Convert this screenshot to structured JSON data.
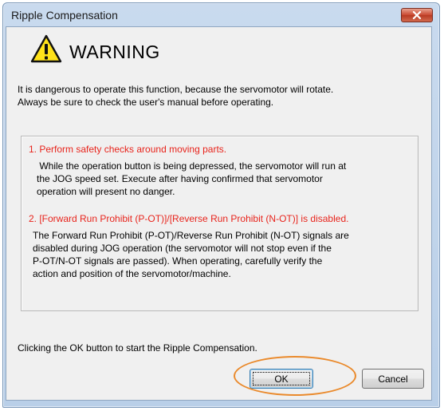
{
  "window": {
    "title": "Ripple Compensation",
    "close_icon": "close-icon"
  },
  "warning": {
    "icon": "warning-triangle-icon",
    "heading": "WARNING",
    "intro_line1": "It is dangerous to operate this function, because the servomotor will rotate.",
    "intro_line2": "Always be sure to check the user's manual before operating."
  },
  "cautions": [
    {
      "heading": "1. Perform safety checks around moving parts.",
      "lines": [
        " While the operation button is being depressed, the servomotor will run at",
        "the JOG speed set. Execute after having confirmed that servomotor",
        "operation will present no danger."
      ]
    },
    {
      "heading": "2. [Forward Run Prohibit (P-OT)]/[Reverse Run Prohibit (N-OT)] is disabled.",
      "lines": [
        "The Forward Run Prohibit (P-OT)/Reverse Run Prohibit (N-OT) signals are",
        "disabled during JOG operation (the servomotor will not stop even if the",
        "P-OT/N-OT signals are passed). When operating, carefully verify the",
        "action and position of the servomotor/machine."
      ]
    }
  ],
  "footer": {
    "text": "Clicking the OK button to start the Ripple Compensation."
  },
  "buttons": {
    "ok": "OK",
    "cancel": "Cancel"
  },
  "colors": {
    "caution_heading": "#e8241c",
    "highlight_ring": "#ea8a2c",
    "close_button": "#c9472f"
  }
}
